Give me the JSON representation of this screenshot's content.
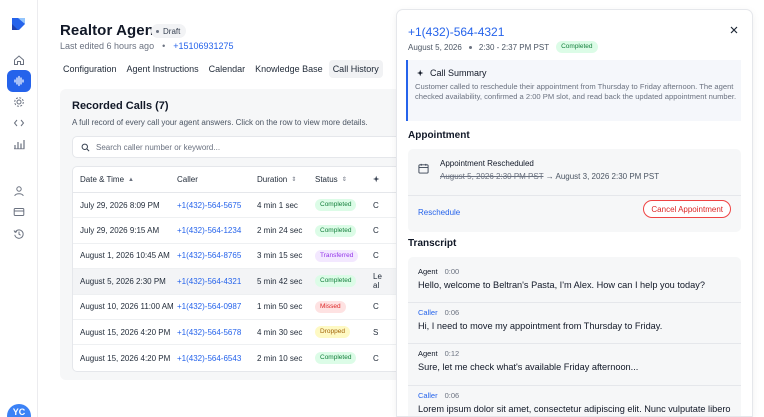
{
  "agent": {
    "title": "Realtor Agent",
    "status": "Draft",
    "last_edited": "Last edited 6 hours ago",
    "phone": "+15106931275"
  },
  "tabs": [
    {
      "label": "Configuration",
      "active": false
    },
    {
      "label": "Agent Instructions",
      "active": false
    },
    {
      "label": "Calendar",
      "active": false
    },
    {
      "label": "Knowledge Base",
      "active": false
    },
    {
      "label": "Call History",
      "active": true
    }
  ],
  "calls": {
    "title": "Recorded Calls (7)",
    "description": "A full record of every call your agent answers. Click on the row to view more details.",
    "search_placeholder": "Search caller number or keyword...",
    "columns": [
      "Date & Time",
      "Caller",
      "Duration",
      "Status"
    ],
    "rows": [
      {
        "date": "July 29, 2026 8:09 PM",
        "caller": "+1(432)-564-5675",
        "duration": "4 min 1 sec",
        "status": "Completed",
        "extra": "C"
      },
      {
        "date": "July 29, 2026 9:15 AM",
        "caller": "+1(432)-564-1234",
        "duration": "2 min 24 sec",
        "status": "Completed",
        "extra": "C"
      },
      {
        "date": "August 1, 2026 10:45 AM",
        "caller": "+1(432)-564-8765",
        "duration": "3 min 15 sec",
        "status": "Transferred",
        "extra": "C"
      },
      {
        "date": "August 5, 2026 2:30 PM",
        "caller": "+1(432)-564-4321",
        "duration": "5 min 42 sec",
        "status": "Completed",
        "extra": "Le",
        "extra2": "al"
      },
      {
        "date": "August 10, 2026 11:00 AM",
        "caller": "+1(432)-564-0987",
        "duration": "1 min 50 sec",
        "status": "Missed",
        "extra": "C"
      },
      {
        "date": "August 15, 2026 4:20 PM",
        "caller": "+1(432)-564-5678",
        "duration": "4 min 30 sec",
        "status": "Dropped",
        "extra": "S"
      },
      {
        "date": "August 15, 2026 4:20 PM",
        "caller": "+1(432)-564-6543",
        "duration": "2 min 10 sec",
        "status": "Completed",
        "extra": "C"
      }
    ]
  },
  "status_colors": {
    "Completed": {
      "bg": "#dcfce7",
      "fg": "#15803d"
    },
    "Transferred": {
      "bg": "#f3e8ff",
      "fg": "#9333ea"
    },
    "Missed": {
      "bg": "#fee2e2",
      "fg": "#dc2626"
    },
    "Dropped": {
      "bg": "#fef9c3",
      "fg": "#a16207"
    }
  },
  "detail": {
    "phone": "+1(432)-564-4321",
    "date": "August 5, 2026",
    "time": "2:30 - 2:37 PM PST",
    "status": "Completed",
    "summary_title": "Call Summary",
    "summary_text": "Customer called to reschedule their appointment from Thursday to Friday afternoon. The agent checked availability, confirmed a 2:00 PM slot, and read back the updated appointment number.",
    "appointment_heading": "Appointment",
    "appointment_title": "Appointment Rescheduled",
    "appointment_old": "August 5, 2026 2:30 PM PST",
    "appointment_arrow": "→",
    "appointment_new": "August 3, 2026 2:30 PM PST",
    "reschedule_label": "Reschedule",
    "cancel_label": "Cancel Appointment",
    "transcript_heading": "Transcript",
    "transcript": [
      {
        "speaker": "Agent",
        "time": "0:00",
        "text": "Hello, welcome to Beltran's Pasta, I'm Alex. How can I help you today?"
      },
      {
        "speaker": "Caller",
        "time": "0:06",
        "text": "Hi, I need to move my appointment from Thursday to Friday."
      },
      {
        "speaker": "Agent",
        "time": "0:12",
        "text": "Sure, let me check what's available Friday afternoon..."
      },
      {
        "speaker": "Caller",
        "time": "0:06",
        "text": "Lorem ipsum dolor sit amet, consectetur adipiscing elit. Nunc vulputate libero"
      }
    ]
  },
  "user": {
    "initials": "YC"
  },
  "accent": "#2563eb"
}
